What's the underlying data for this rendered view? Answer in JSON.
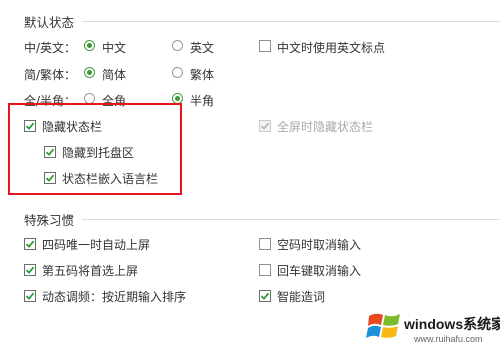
{
  "default_state": {
    "title": "默认状态",
    "rows": [
      {
        "label": "中/英文：",
        "opt1": "中文",
        "opt2": "英文",
        "selected": 1
      },
      {
        "label": "简/繁体：",
        "opt1": "简体",
        "opt2": "繁体",
        "selected": 1
      },
      {
        "label": "全/半角：",
        "opt1": "全角",
        "opt2": "半角",
        "selected": 2
      }
    ],
    "use_english_punct": {
      "label": "中文时使用英文标点",
      "checked": false
    },
    "hide_statusbar": {
      "label": "隐藏状态栏",
      "checked": true
    },
    "hide_to_tray": {
      "label": "隐藏到托盘区",
      "checked": true
    },
    "embed_in_langbar": {
      "label": "状态栏嵌入语言栏",
      "checked": true
    },
    "fullscreen_hide": {
      "label": "全屏时隐藏状态栏",
      "checked": true,
      "disabled": true
    }
  },
  "special_habits": {
    "title": "特殊习惯",
    "left": [
      {
        "label": "四码唯一时自动上屏",
        "checked": true
      },
      {
        "label": "第五码将首选上屏",
        "checked": true
      },
      {
        "label": "动态调频：按近期输入排序",
        "checked": true
      }
    ],
    "right": [
      {
        "label": "空码时取消输入",
        "checked": false
      },
      {
        "label": "回车键取消输入",
        "checked": false
      },
      {
        "label": "智能造词",
        "checked": true
      }
    ]
  },
  "watermark": {
    "brand": "windows系统家园",
    "url": "www.ruihafu.com"
  },
  "colors": {
    "highlight": "#e8141d",
    "radio_accent": "#3b9a35",
    "check_accent": "#2f9a2f"
  }
}
